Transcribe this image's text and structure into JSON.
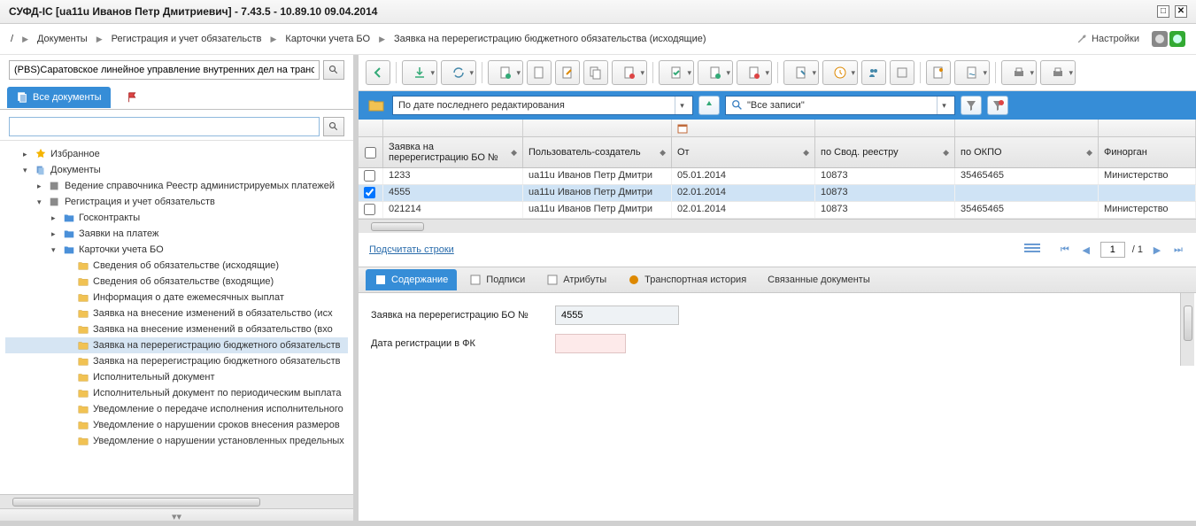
{
  "window": {
    "title": "СУФД-IС [ua11u Иванов Петр Дмитриевич] - 7.43.5 - 10.89.10 09.04.2014"
  },
  "breadcrumb": {
    "root": "/",
    "items": [
      "Документы",
      "Регистрация и учет обязательств",
      "Карточки учета БО",
      "Заявка на перерегистрацию бюджетного обязательства (исходящие)"
    ],
    "settings_label": "Настройки"
  },
  "sidebar": {
    "org_text": "(PBS)Саратовское линейное управление внутренних дел на транс",
    "tab_label": "Все документы",
    "favorites": "Избранное",
    "documents": "Документы",
    "items": {
      "a": "Ведение справочника Реестр администрируемых платежей",
      "b": "Регистрация и учет обязательств",
      "c": "Госконтракты",
      "d": "Заявки на платеж",
      "e": "Карточки учета БО",
      "f": "Сведения об обязательстве (исходящие)",
      "g": "Сведения об обязательстве (входящие)",
      "h": "Информация о дате ежемесячных выплат",
      "i": "Заявка на внесение изменений в обязательство (исх",
      "j": "Заявка на внесение изменений в обязательство (вхо",
      "k": "Заявка на перерегистрацию бюджетного обязательств",
      "l": "Заявка на перерегистрацию бюджетного обязательств",
      "m": "Исполнительный документ",
      "n": "Исполнительный документ по периодическим выплата",
      "o": "Уведомление о передаче исполнения исполнительного",
      "p": "Уведомление о нарушении сроков внесения размеров",
      "q": "Уведомление о нарушении установленных предельных"
    }
  },
  "filter": {
    "f1": "По дате последнего редактирования",
    "f2": "\"Все записи\""
  },
  "grid": {
    "headers": {
      "num": "Заявка на перерегистрацию БО №",
      "user": "Пользователь-создатель",
      "from": "От",
      "reg": "по Свод. реестру",
      "okpo": "по ОКПО",
      "fin": "Финорган"
    },
    "rows": [
      {
        "num": "1233",
        "user": "ua11u Иванов Петр Дмитри",
        "from": "05.01.2014",
        "reg": "10873",
        "okpo": "35465465",
        "fin": "Министерство"
      },
      {
        "num": "4555",
        "user": "ua11u Иванов Петр Дмитри",
        "from": "02.01.2014",
        "reg": "10873",
        "okpo": "",
        "fin": ""
      },
      {
        "num": "021214",
        "user": "ua11u Иванов Петр Дмитри",
        "from": "02.01.2014",
        "reg": "10873",
        "okpo": "35465465",
        "fin": "Министерство"
      }
    ]
  },
  "count_link": "Подсчитать строки",
  "pager": {
    "page": "1",
    "total": "/ 1"
  },
  "detail_tabs": {
    "t1": "Содержание",
    "t2": "Подписи",
    "t3": "Атрибуты",
    "t4": "Транспортная история",
    "t5": "Связанные документы"
  },
  "form": {
    "label1": "Заявка на перерегистрацию БО №",
    "value1": "4555",
    "label2": "Дата регистрации в ФК"
  }
}
